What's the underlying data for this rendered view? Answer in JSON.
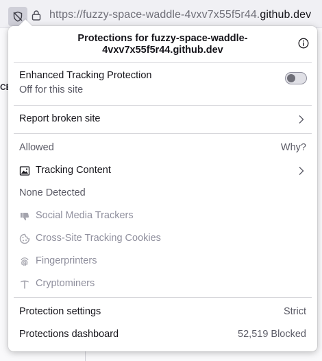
{
  "urlbar": {
    "url_prefix": "https://fuzzy-space-waddle-4vxv7x55f5r44.",
    "url_host": "github.dev"
  },
  "background": {
    "partial_text": "CE"
  },
  "panel": {
    "title": "Protections for fuzzy-space-waddle-4vxv7x55f5r44.github.dev",
    "etp": {
      "title": "Enhanced Tracking Protection",
      "status": "Off for this site",
      "enabled": false
    },
    "report_broken_site": "Report broken site",
    "allowed_label": "Allowed",
    "why_label": "Why?",
    "tracking_content": "Tracking Content",
    "none_detected": "None Detected",
    "blocked_categories": [
      {
        "label": "Social Media Trackers",
        "icon": "thumbs-down-icon"
      },
      {
        "label": "Cross-Site Tracking Cookies",
        "icon": "cookie-icon"
      },
      {
        "label": "Fingerprinters",
        "icon": "fingerprint-icon"
      },
      {
        "label": "Cryptominers",
        "icon": "pickaxe-icon"
      }
    ],
    "protection_settings": {
      "label": "Protection settings",
      "value": "Strict"
    },
    "protections_dashboard": {
      "label": "Protections dashboard",
      "value": "52,519 Blocked"
    }
  }
}
